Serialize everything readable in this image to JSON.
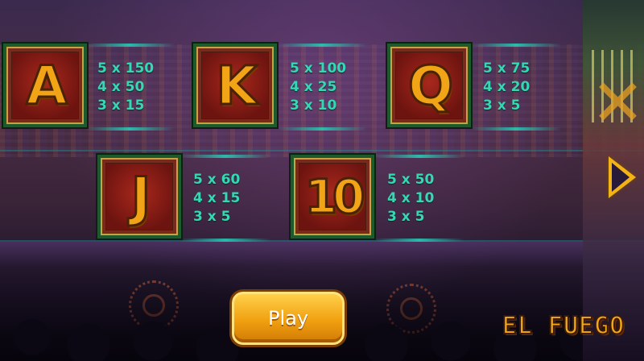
{
  "paytable": {
    "symbols": [
      {
        "symbol": "A",
        "payouts": [
          "5 x 150",
          "4 x 50",
          "3 x 15"
        ]
      },
      {
        "symbol": "K",
        "payouts": [
          "5 x 100",
          "4 x 25",
          "3 x 10"
        ]
      },
      {
        "symbol": "Q",
        "payouts": [
          "5 x 75",
          "4 x 20",
          "3 x 5"
        ]
      },
      {
        "symbol": "J",
        "payouts": [
          "5 x 60",
          "4 x 15",
          "3 x 5"
        ]
      },
      {
        "symbol": "10",
        "payouts": [
          "5 x 50",
          "4 x 10",
          "3 x 5"
        ]
      }
    ]
  },
  "controls": {
    "play_label": "Play"
  },
  "branding": {
    "logo_text": "EL FUEGO"
  },
  "colors": {
    "payout_text": "#35d7b4",
    "symbol_gold": "#f0a416",
    "play_button": "#f0a010",
    "symbol_frame": "#1d5a2c"
  },
  "icons": {
    "next_page": "right-arrow-icon"
  }
}
